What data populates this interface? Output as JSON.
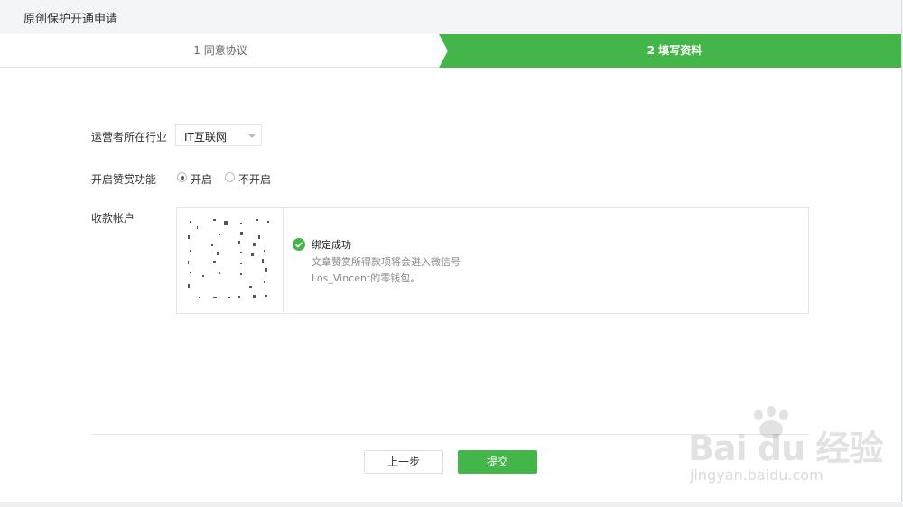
{
  "header": {
    "title": "原创保护开通申请"
  },
  "steps": [
    {
      "label": "1 同意协议",
      "active": false
    },
    {
      "label": "2 填写资料",
      "active": true
    }
  ],
  "form": {
    "industry": {
      "label": "运营者所在行业",
      "value": "IT互联网"
    },
    "reward": {
      "label": "开启赞赏功能",
      "options": [
        "开启",
        "不开启"
      ],
      "selected": "开启"
    },
    "account": {
      "label": "收款帐户",
      "status": "绑定成功",
      "line1": "文章赞赏所得款项将会进入微信号",
      "line2": "Los_Vincent的零钱包。"
    }
  },
  "buttons": {
    "prev": "上一步",
    "submit": "提交"
  },
  "watermark": {
    "brand": "Bai du 经验",
    "url": "jingyan.baidu.com"
  },
  "colors": {
    "accent": "#44b549",
    "title_bg": "#f4f5f9"
  }
}
